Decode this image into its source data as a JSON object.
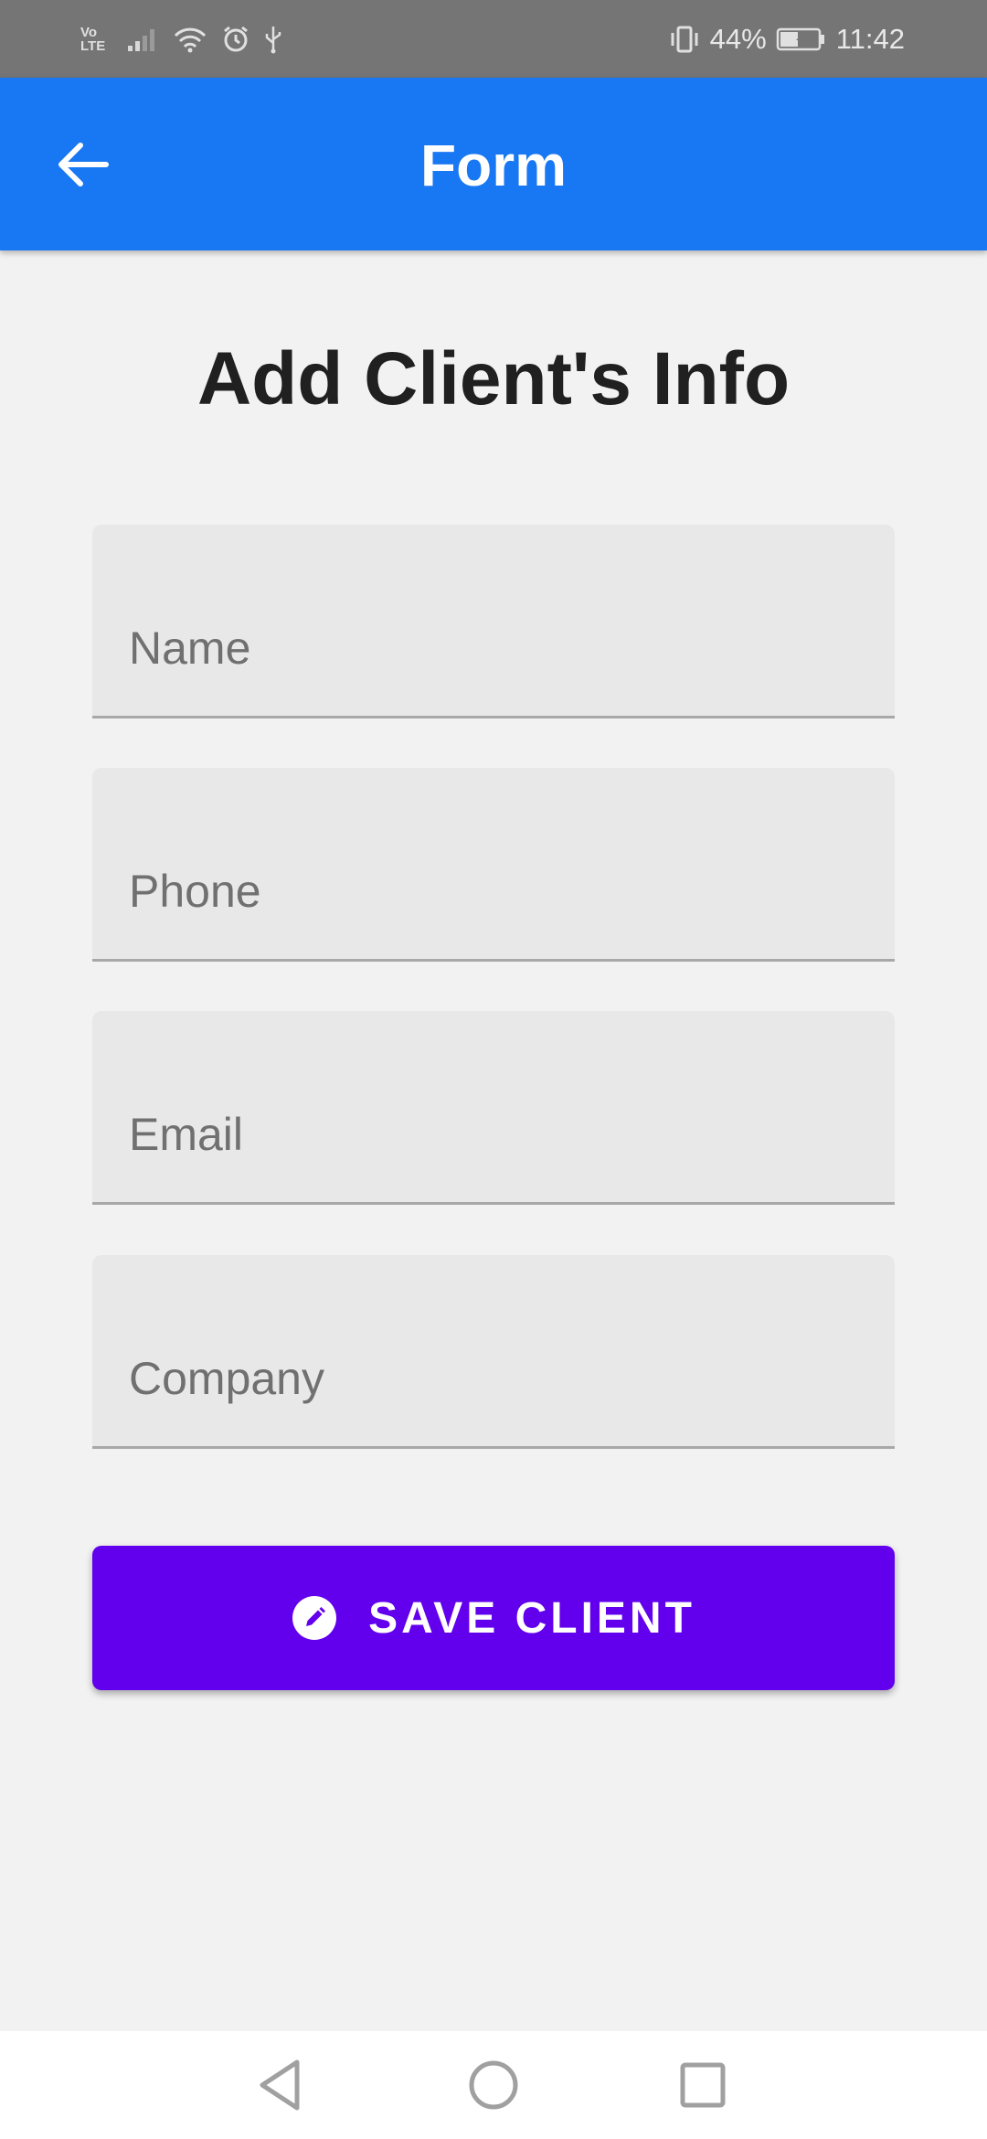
{
  "status_bar": {
    "network_label_top": "Vo",
    "network_label_bottom": "LTE",
    "battery_percent": "44%",
    "time": "11:42"
  },
  "app_bar": {
    "title": "Form",
    "back_icon": "arrow-left-icon"
  },
  "page": {
    "heading": "Add Client's Info"
  },
  "form": {
    "fields": [
      {
        "placeholder": "Name",
        "value": ""
      },
      {
        "placeholder": "Phone",
        "value": ""
      },
      {
        "placeholder": "Email",
        "value": ""
      },
      {
        "placeholder": "Company",
        "value": ""
      }
    ],
    "save_button": {
      "label": "SAVE CLIENT",
      "icon": "pencil-icon"
    }
  },
  "nav_bar": {
    "back": "triangle-back-icon",
    "home": "circle-home-icon",
    "recents": "square-recents-icon"
  },
  "colors": {
    "app_bar": "#1877f2",
    "button": "#6200ee",
    "status_bar": "#757575",
    "background": "#f2f2f2"
  }
}
